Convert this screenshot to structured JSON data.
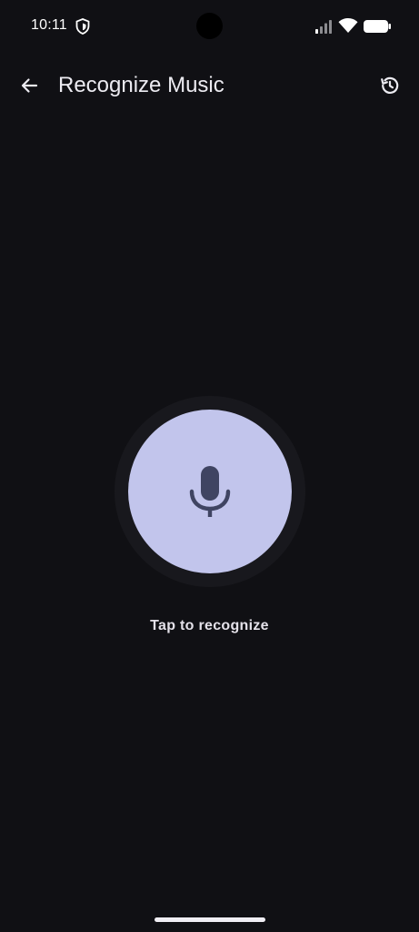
{
  "status_bar": {
    "time": "10:11",
    "icons": [
      "shield-icon",
      "signal-icon",
      "wifi-icon",
      "battery-icon"
    ]
  },
  "app_bar": {
    "title": "Recognize Music",
    "back_icon": "arrow-back-icon",
    "history_icon": "history-icon"
  },
  "main": {
    "mic_icon": "microphone-icon",
    "tap_label": "Tap to recognize"
  },
  "colors": {
    "background": "#101014",
    "mic_button": "#c2c5ec",
    "mic_ring": "#18181d",
    "mic_glyph": "#3f4462",
    "text": "#ecebf1"
  }
}
